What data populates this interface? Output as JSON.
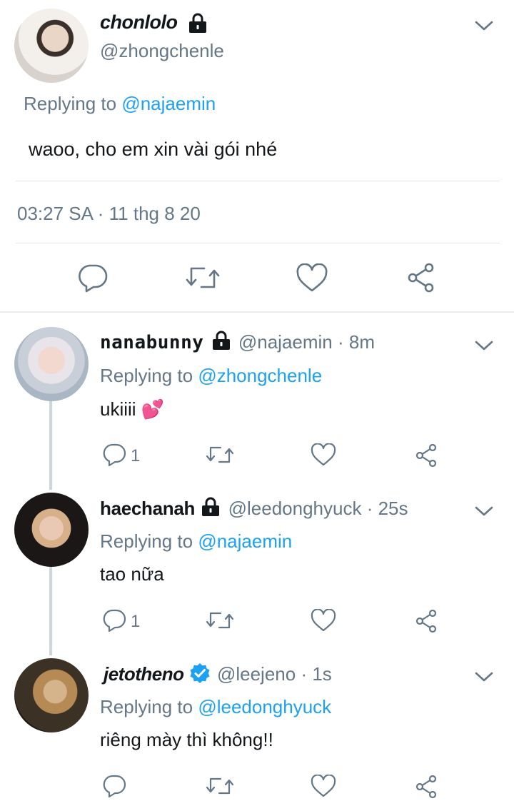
{
  "main_tweet": {
    "display_name": "chonlolo",
    "handle": "@zhongchenle",
    "replying_prefix": "Replying to ",
    "replying_to": "@najaemin",
    "text": "waoo, cho em xin vài gói nhé",
    "timestamp": "03:27 SA · 11 thg 8 20",
    "protected": true
  },
  "replies": [
    {
      "display_name": "nanabunny",
      "handle": "@najaemin",
      "time": " · 8m",
      "replying_prefix": "Replying to ",
      "replying_to": "@zhongchenle",
      "text": "ukiiii",
      "emoji": "💕",
      "reply_count": "1",
      "protected": true
    },
    {
      "display_name": "haechanah",
      "handle": "@leedonghyuck",
      "time": " · 25s",
      "replying_prefix": "Replying to ",
      "replying_to": "@najaemin",
      "text": "tao nữa",
      "reply_count": "1",
      "protected": true
    },
    {
      "display_name": "jetotheno",
      "handle": "@leejeno",
      "time": " · 1s",
      "replying_prefix": "Replying to ",
      "replying_to": "@leedonghyuck",
      "text": "riêng mày thì không!!",
      "verified": true
    }
  ],
  "icons": [
    "reply-icon",
    "retweet-icon",
    "like-icon",
    "share-icon",
    "lock-icon",
    "verified-icon",
    "chevron-down-icon"
  ],
  "colors": {
    "link": "#1da1f2",
    "secondary_text": "#657786",
    "divider": "#e1e8ed",
    "thread_line": "#ccd6dd",
    "heart_emoji": "#e0245e"
  }
}
